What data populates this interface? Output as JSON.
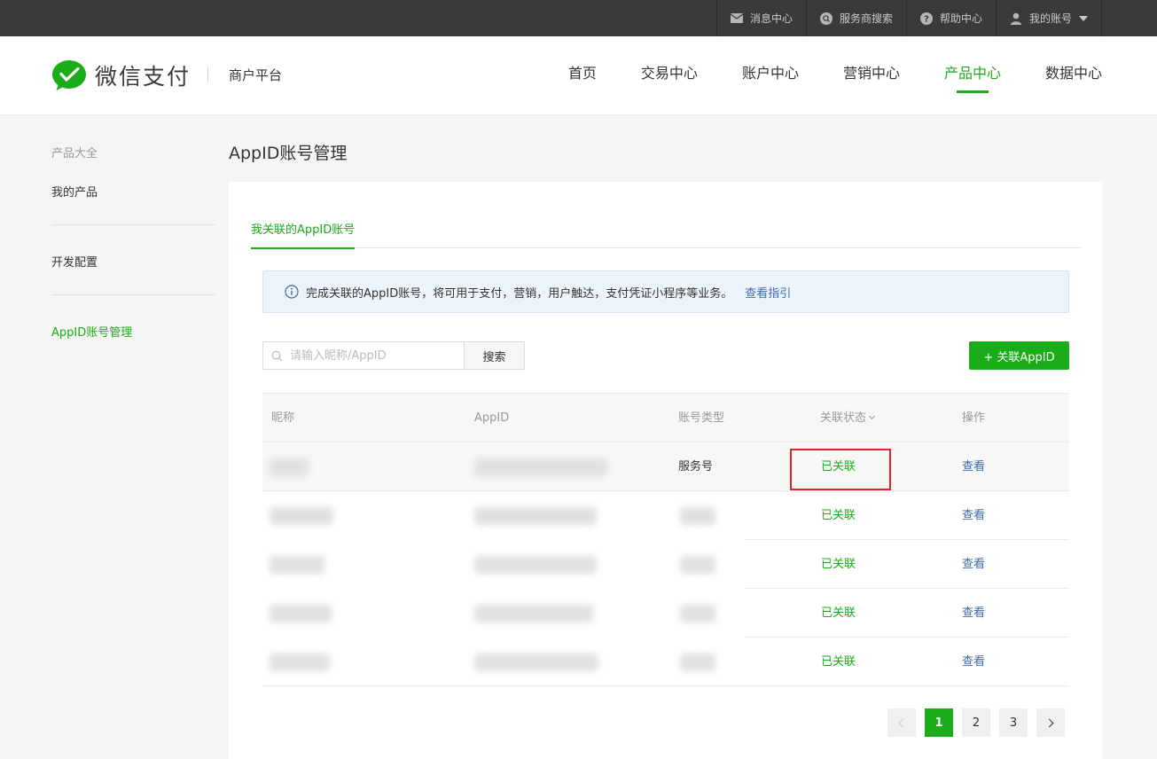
{
  "topbar": {
    "items": [
      {
        "label": "消息中心",
        "icon": "envelope-icon"
      },
      {
        "label": "服务商搜索",
        "icon": "search-circle-icon"
      },
      {
        "label": "帮助中心",
        "icon": "help-icon"
      },
      {
        "label": "我的账号",
        "icon": "user-icon"
      }
    ]
  },
  "header": {
    "logo_text": "微信支付",
    "logo_sub": "商户平台",
    "nav": [
      "首页",
      "交易中心",
      "账户中心",
      "营销中心",
      "产品中心",
      "数据中心"
    ],
    "active_nav": "产品中心"
  },
  "sidebar": {
    "group_label": "产品大全",
    "items": [
      "我的产品",
      "开发配置",
      "AppID账号管理"
    ],
    "active": "AppID账号管理"
  },
  "main": {
    "title": "AppID账号管理",
    "tab": "我关联的AppID账号",
    "notice": {
      "text": "完成关联的AppID账号，将可用于支付，营销，用户触达，支付凭证小程序等业务。",
      "link": "查看指引"
    },
    "search": {
      "placeholder": "请输入昵称/AppID",
      "button": "搜索"
    },
    "add_button": "+ 关联AppID",
    "table": {
      "headers": [
        "昵称",
        "AppID",
        "账号类型",
        "关联状态",
        "操作"
      ],
      "rows": [
        {
          "type": "服务号",
          "status": "已关联",
          "action": "查看"
        },
        {
          "type": "",
          "status": "已关联",
          "action": "查看"
        },
        {
          "type": "",
          "status": "已关联",
          "action": "查看"
        },
        {
          "type": "",
          "status": "已关联",
          "action": "查看"
        },
        {
          "type": "",
          "status": "已关联",
          "action": "查看"
        }
      ]
    },
    "pagination": {
      "pages": [
        "1",
        "2",
        "3"
      ],
      "current": "1"
    }
  },
  "colors": {
    "brand_green": "#1aad19",
    "link_blue": "#3c6caa",
    "highlight_red": "#e5212a"
  }
}
